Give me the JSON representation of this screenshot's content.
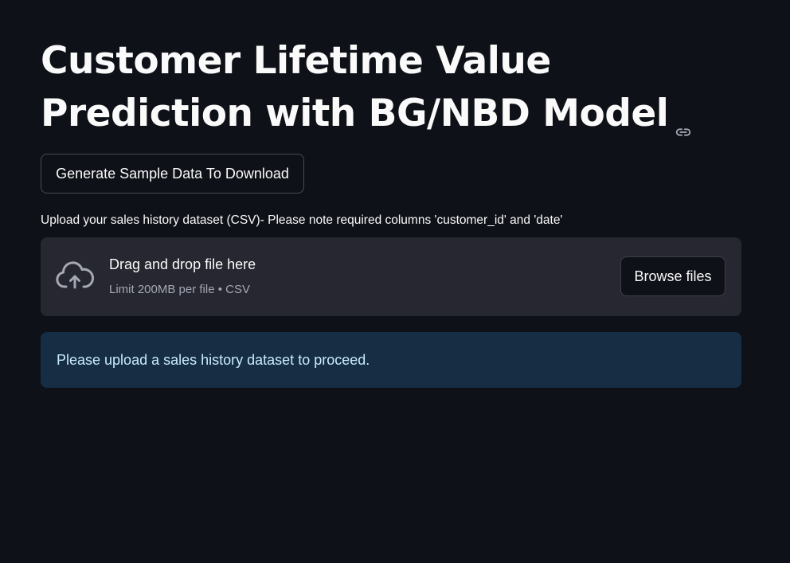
{
  "header": {
    "title": "Customer Lifetime Value Prediction with BG/NBD Model",
    "link_icon": "link-icon"
  },
  "actions": {
    "generate_label": "Generate Sample Data To Download"
  },
  "uploader": {
    "label": "Upload your sales history dataset (CSV)- Please note required columns 'customer_id' and 'date'",
    "dropzone_title": "Drag and drop file here",
    "dropzone_limit": "Limit 200MB per file • CSV",
    "browse_label": "Browse files",
    "icon": "cloud-upload-icon"
  },
  "info": {
    "message": "Please upload a sales history dataset to proceed."
  },
  "colors": {
    "background": "#0e1117",
    "dropzone_bg": "#262730",
    "info_bg": "#172d43",
    "info_text": "#c7ebff"
  }
}
